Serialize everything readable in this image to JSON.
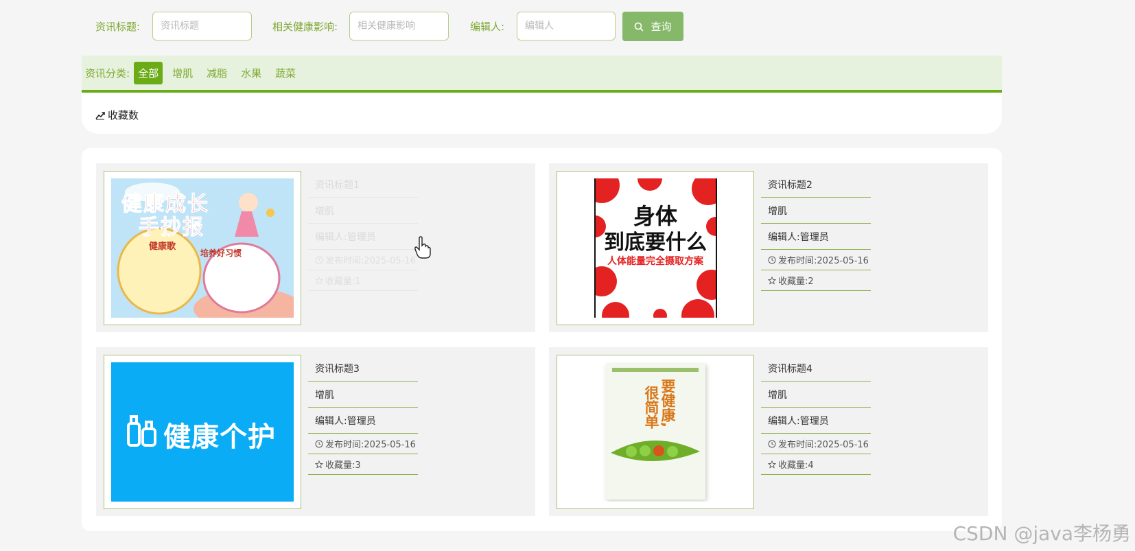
{
  "search": {
    "title_label": "资讯标题:",
    "title_placeholder": "资讯标题",
    "health_label": "相关健康影响:",
    "health_placeholder": "相关健康影响",
    "editor_label": "编辑人:",
    "editor_placeholder": "编辑人",
    "query_button": "查询",
    "query_icon": "search-icon"
  },
  "categories": {
    "label": "资讯分类:",
    "items": [
      "全部",
      "增肌",
      "减脂",
      "水果",
      "蔬菜"
    ],
    "active": "全部"
  },
  "sort": {
    "option_label": "收藏数",
    "icon": "trend-chart-icon"
  },
  "cards": [
    {
      "title": "资讯标题1",
      "category": "增肌",
      "editor": "编辑人:管理员",
      "publish": "发布时间:2025-05-16",
      "favorites": "收藏量:1",
      "image": "健康成长手抄报 poster",
      "poster_title_1": "健康成长",
      "poster_title_2": "手抄报",
      "poster_song": "健康歌",
      "poster_habit": "培养好习惯"
    },
    {
      "title": "资讯标题2",
      "category": "增肌",
      "editor": "编辑人:管理员",
      "publish": "发布时间:2025-05-16",
      "favorites": "收藏量:2",
      "image": "身体到底要什么 book cover",
      "cover_line_1": "身体",
      "cover_line_2": "到底要什么",
      "cover_subtitle": "人体能量完全摄取方案"
    },
    {
      "title": "资讯标题3",
      "category": "增肌",
      "editor": "编辑人:管理员",
      "publish": "发布时间:2025-05-16",
      "favorites": "收藏量:3",
      "image": "健康个护 banner",
      "banner_text": "健康个护"
    },
    {
      "title": "资讯标题4",
      "category": "增肌",
      "editor": "编辑人:管理员",
      "publish": "发布时间:2025-05-16",
      "favorites": "收藏量:4",
      "image": "要健康很简单 book cover",
      "book_line_1": "要健康,",
      "book_line_2": "很简单"
    }
  ],
  "icons": {
    "clock": "clock-icon",
    "star": "star-outline-icon"
  },
  "watermark": "CSDN @java李杨勇",
  "colors": {
    "accent": "#6aab16",
    "label_green": "#7fa832",
    "button_green": "#86b86a",
    "strip_bg": "#e6f2dd",
    "card_bg": "#f2f2f2"
  }
}
